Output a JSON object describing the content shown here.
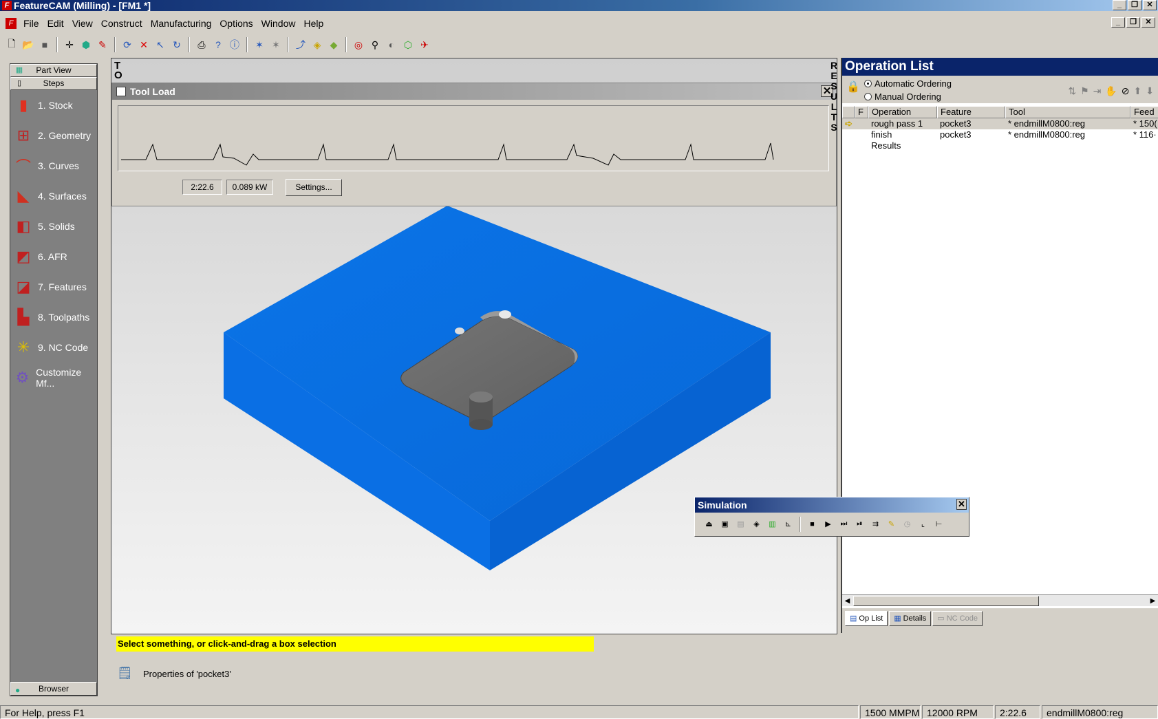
{
  "window": {
    "title": "FeatureCAM (Milling) - [FM1 *]",
    "app_icon": "F"
  },
  "menu": [
    "File",
    "Edit",
    "View",
    "Construct",
    "Manufacturing",
    "Options",
    "Window",
    "Help"
  ],
  "steps_panel": {
    "part_view": "Part View",
    "steps": "Steps",
    "items": [
      {
        "label": "1. Stock",
        "icon": "stock-icon"
      },
      {
        "label": "2. Geometry",
        "icon": "geometry-icon"
      },
      {
        "label": "3. Curves",
        "icon": "curves-icon"
      },
      {
        "label": "4. Surfaces",
        "icon": "surfaces-icon"
      },
      {
        "label": "5. Solids",
        "icon": "solids-icon"
      },
      {
        "label": "6. AFR",
        "icon": "afr-icon"
      },
      {
        "label": "7. Features",
        "icon": "features-icon"
      },
      {
        "label": "8. Toolpaths",
        "icon": "toolpaths-icon"
      },
      {
        "label": "9. NC Code",
        "icon": "nc-code-icon"
      },
      {
        "label": "Customize Mf...",
        "icon": "customize-icon"
      }
    ],
    "browser": "Browser"
  },
  "viewport": {
    "side_tab": "T O"
  },
  "tool_load": {
    "title": "Tool Load",
    "time": "2:22.6",
    "power": "0.089 kW",
    "settings_label": "Settings..."
  },
  "results_tab": "R E S U L T S",
  "operation_list": {
    "title": "Operation List",
    "automatic": "Automatic Ordering",
    "manual": "Manual Ordering",
    "ordering": "automatic",
    "columns": [
      "F",
      "Operation",
      "Feature",
      "Tool",
      "Feed"
    ],
    "rows": [
      {
        "operation": "rough pass 1",
        "feature": "pocket3",
        "tool": "* endmillM0800:reg",
        "feed": "* 150(",
        "current": true
      },
      {
        "operation": "finish",
        "feature": "pocket3",
        "tool": "* endmillM0800:reg",
        "feed": "* 116·",
        "current": false
      },
      {
        "operation": "Results",
        "feature": "",
        "tool": "",
        "feed": "",
        "current": false
      }
    ],
    "tabs": [
      "Op List",
      "Details",
      "NC Code"
    ]
  },
  "simulation": {
    "title": "Simulation"
  },
  "message": "Select something, or click-and-drag a box selection",
  "properties": "Properties of 'pocket3'",
  "status": {
    "help": "For Help, press F1",
    "feed": "1500 MMPM",
    "rpm": "12000 RPM",
    "time": "2:22.6",
    "tool": "endmillM0800:reg"
  },
  "colors": {
    "stock": "#0a6ee0",
    "pocket": "#6e6e6e",
    "highlight": "#ffff00",
    "title_bar": "#0a246a"
  }
}
